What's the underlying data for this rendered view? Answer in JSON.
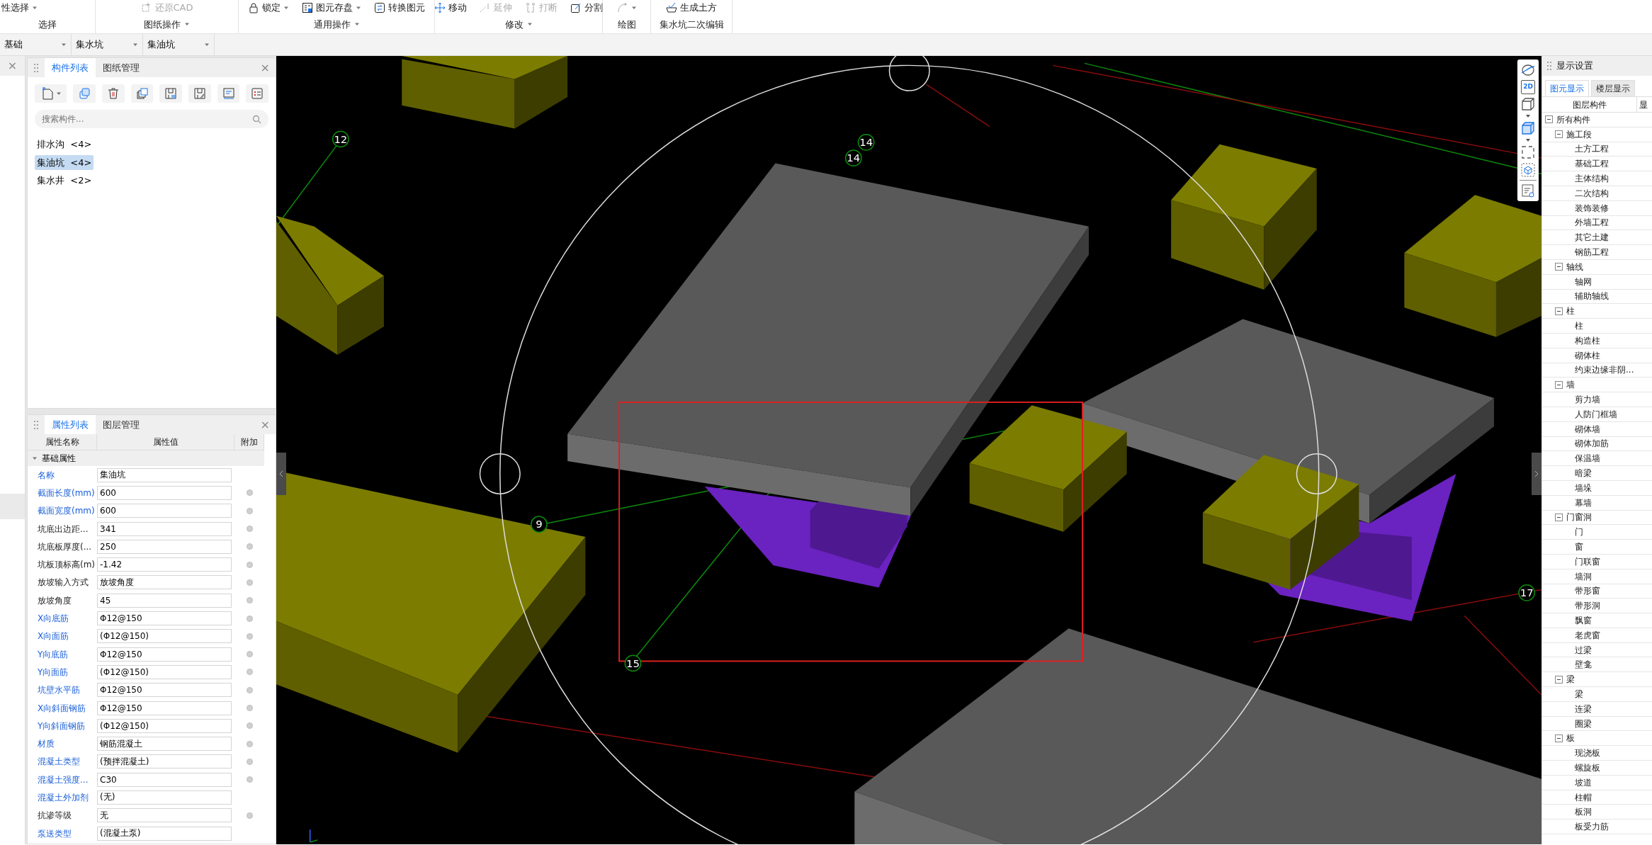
{
  "ribbon": {
    "groups": [
      {
        "label": "选择",
        "menu": false,
        "tools": [
          {
            "label": "性选择",
            "menu": true,
            "disabled": false
          }
        ]
      },
      {
        "label": "图纸操作",
        "menu": true,
        "tools": [
          {
            "label": "还原CAD",
            "menu": false,
            "disabled": true
          }
        ]
      },
      {
        "label": "通用操作",
        "menu": true,
        "tools": [
          {
            "label": "锁定",
            "menu": true,
            "disabled": false
          },
          {
            "label": "图元存盘",
            "menu": true,
            "disabled": false
          },
          {
            "label": "转换图元",
            "menu": false,
            "disabled": false
          }
        ]
      },
      {
        "label": "修改",
        "menu": true,
        "tools": [
          {
            "label": "移动",
            "menu": false,
            "disabled": false
          },
          {
            "label": "延伸",
            "menu": false,
            "disabled": true
          },
          {
            "label": "打断",
            "menu": false,
            "disabled": true
          },
          {
            "label": "分割",
            "menu": false,
            "disabled": false
          }
        ]
      },
      {
        "label": "绘图",
        "menu": false,
        "tools": [
          {
            "menu": true,
            "disabled": true
          }
        ]
      },
      {
        "label": "集水坑二次编辑",
        "menu": false,
        "tools": [
          {
            "label": "生成土方",
            "menu": false,
            "disabled": false
          }
        ]
      }
    ]
  },
  "selectors": [
    {
      "value": "基础"
    },
    {
      "value": "集水坑"
    },
    {
      "value": "集油坑"
    }
  ],
  "left_strip": {
    "close": "×"
  },
  "component_panel": {
    "close": "×",
    "tabs": [
      {
        "label": "构件列表",
        "selected": true
      },
      {
        "label": "图纸管理",
        "selected": false
      }
    ],
    "search": {
      "placeholder": "搜索构件..."
    },
    "items": [
      {
        "name": "排水沟",
        "count": "<4>",
        "selected": false
      },
      {
        "name": "集油坑",
        "count": "<4>",
        "selected": true
      },
      {
        "name": "集水井",
        "count": "<2>",
        "selected": false
      }
    ]
  },
  "property_panel": {
    "close": "×",
    "tabs": [
      {
        "label": "属性列表",
        "selected": true
      },
      {
        "label": "图层管理",
        "selected": false
      }
    ],
    "columns": [
      "属性名称",
      "属性值",
      "附加"
    ],
    "group": {
      "label": "基础属性",
      "expanded": true
    },
    "rows": [
      {
        "name": "名称",
        "value": "集油坑",
        "public": true,
        "addon": false
      },
      {
        "name": "截面长度(mm)",
        "value": "600",
        "public": true,
        "addon": true
      },
      {
        "name": "截面宽度(mm)",
        "value": "600",
        "public": true,
        "addon": true
      },
      {
        "name": "坑底出边距...",
        "value": "341",
        "public": false,
        "addon": true
      },
      {
        "name": "坑底板厚度(...",
        "value": "250",
        "public": false,
        "addon": true
      },
      {
        "name": "坑板顶标高(m)",
        "value": "-1.42",
        "public": false,
        "addon": true
      },
      {
        "name": "放坡输入方式",
        "value": "放坡角度",
        "public": false,
        "addon": true
      },
      {
        "name": "放坡角度",
        "value": "45",
        "public": false,
        "addon": true
      },
      {
        "name": "X向底筋",
        "value": "Φ12@150",
        "public": true,
        "addon": true
      },
      {
        "name": "X向面筋",
        "value": "(Φ12@150)",
        "public": true,
        "addon": true
      },
      {
        "name": "Y向底筋",
        "value": "Φ12@150",
        "public": true,
        "addon": true
      },
      {
        "name": "Y向面筋",
        "value": "(Φ12@150)",
        "public": true,
        "addon": true
      },
      {
        "name": "坑壁水平筋",
        "value": "Φ12@150",
        "public": true,
        "addon": true
      },
      {
        "name": "X向斜面钢筋",
        "value": "Φ12@150",
        "public": true,
        "addon": true
      },
      {
        "name": "Y向斜面钢筋",
        "value": "(Φ12@150)",
        "public": true,
        "addon": true
      },
      {
        "name": "材质",
        "value": "钢筋混凝土",
        "public": true,
        "addon": true
      },
      {
        "name": "混凝土类型",
        "value": "(预拌混凝土)",
        "public": true,
        "addon": true
      },
      {
        "name": "混凝土强度...",
        "value": "C30",
        "public": true,
        "addon": true
      },
      {
        "name": "混凝土外加剂",
        "value": "(无)",
        "public": true,
        "addon": false
      },
      {
        "name": "抗渗等级",
        "value": "无",
        "public": false,
        "addon": true
      },
      {
        "name": "泵送类型",
        "value": "(混凝土泵)",
        "public": true,
        "addon": false
      }
    ]
  },
  "viewport": {
    "axis_labels": [
      {
        "text": "12"
      },
      {
        "text": "14"
      },
      {
        "text": "14"
      },
      {
        "text": "9"
      },
      {
        "text": "15"
      },
      {
        "text": "17"
      }
    ]
  },
  "view_toolbar": {
    "mode_2d": "2D"
  },
  "right_panel": {
    "title": "显示设置",
    "tabs": [
      {
        "label": "图元显示",
        "selected": true
      },
      {
        "label": "楼层显示",
        "selected": false
      }
    ],
    "columns": [
      "图层构件",
      "显"
    ],
    "tree": [
      {
        "label": "所有构件",
        "expanded": true,
        "children": [
          {
            "label": "施工段",
            "expanded": true,
            "children": [
              {
                "label": "土方工程"
              },
              {
                "label": "基础工程"
              },
              {
                "label": "主体结构"
              },
              {
                "label": "二次结构"
              },
              {
                "label": "装饰装修"
              },
              {
                "label": "外墙工程"
              },
              {
                "label": "其它土建"
              },
              {
                "label": "钢筋工程"
              }
            ]
          },
          {
            "label": "轴线",
            "expanded": true,
            "children": [
              {
                "label": "轴网"
              },
              {
                "label": "辅助轴线"
              }
            ]
          },
          {
            "label": "柱",
            "expanded": true,
            "children": [
              {
                "label": "柱"
              },
              {
                "label": "构造柱"
              },
              {
                "label": "砌体柱"
              },
              {
                "label": "约束边缘非阴..."
              }
            ]
          },
          {
            "label": "墙",
            "expanded": true,
            "children": [
              {
                "label": "剪力墙"
              },
              {
                "label": "人防门框墙"
              },
              {
                "label": "砌体墙"
              },
              {
                "label": "砌体加筋"
              },
              {
                "label": "保温墙"
              },
              {
                "label": "暗梁"
              },
              {
                "label": "墙垛"
              },
              {
                "label": "幕墙"
              }
            ]
          },
          {
            "label": "门窗洞",
            "expanded": true,
            "children": [
              {
                "label": "门"
              },
              {
                "label": "窗"
              },
              {
                "label": "门联窗"
              },
              {
                "label": "墙洞"
              },
              {
                "label": "带形窗"
              },
              {
                "label": "带形洞"
              },
              {
                "label": "飘窗"
              },
              {
                "label": "老虎窗"
              },
              {
                "label": "过梁"
              },
              {
                "label": "壁龛"
              }
            ]
          },
          {
            "label": "梁",
            "expanded": true,
            "children": [
              {
                "label": "梁"
              },
              {
                "label": "连梁"
              },
              {
                "label": "圈梁"
              }
            ]
          },
          {
            "label": "板",
            "expanded": true,
            "children": [
              {
                "label": "现浇板"
              },
              {
                "label": "螺旋板"
              },
              {
                "label": "坡道"
              },
              {
                "label": "柱帽"
              },
              {
                "label": "板洞"
              },
              {
                "label": "板受力筋"
              }
            ]
          }
        ]
      }
    ]
  }
}
